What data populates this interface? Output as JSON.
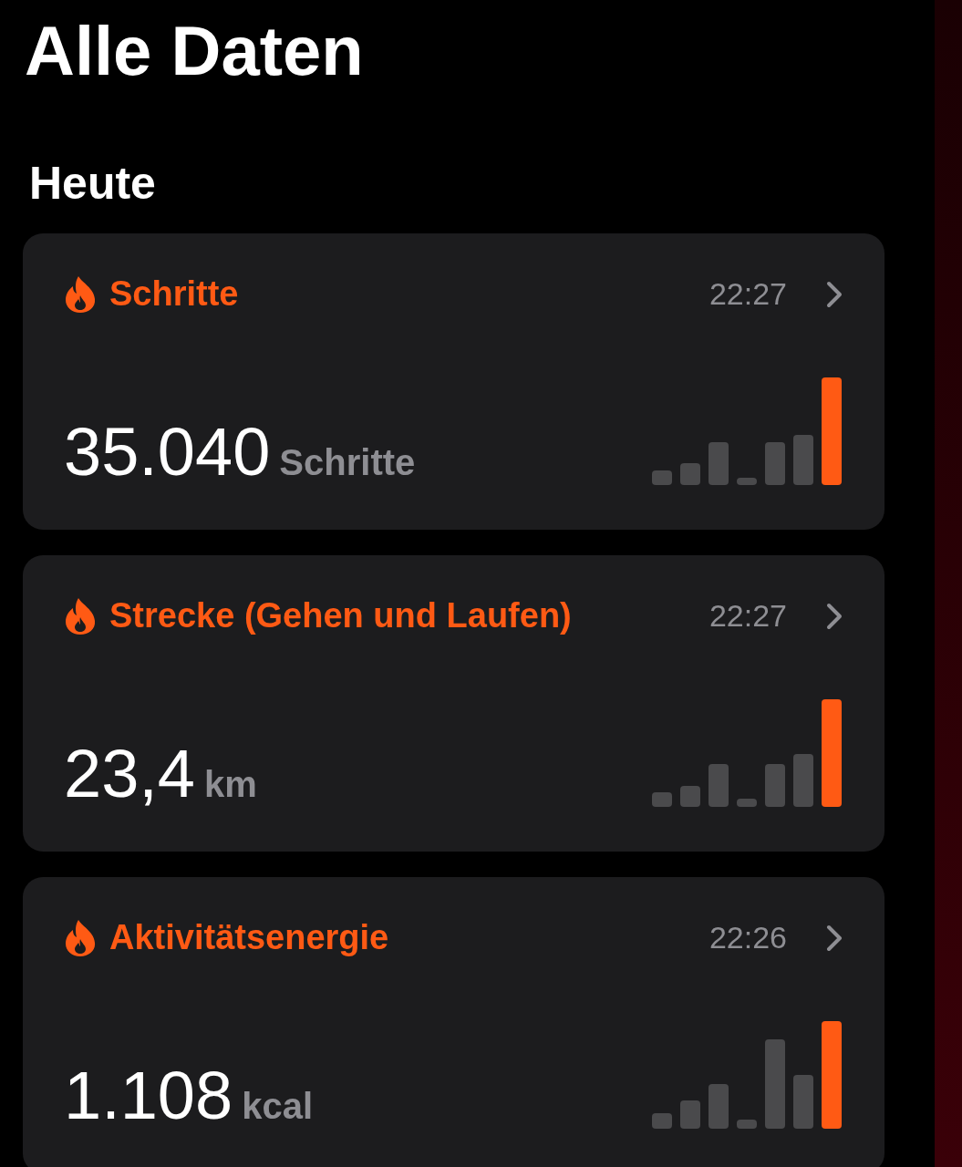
{
  "title": "Alle Daten",
  "section": "Heute",
  "cards": [
    {
      "label": "Schritte",
      "time": "22:27",
      "value": "35.040",
      "unit": "Schritte"
    },
    {
      "label": "Strecke (Gehen und Laufen)",
      "time": "22:27",
      "value": "23,4",
      "unit": "km"
    },
    {
      "label": "Aktivitätsenergie",
      "time": "22:26",
      "value": "1.108",
      "unit": "kcal"
    }
  ]
}
